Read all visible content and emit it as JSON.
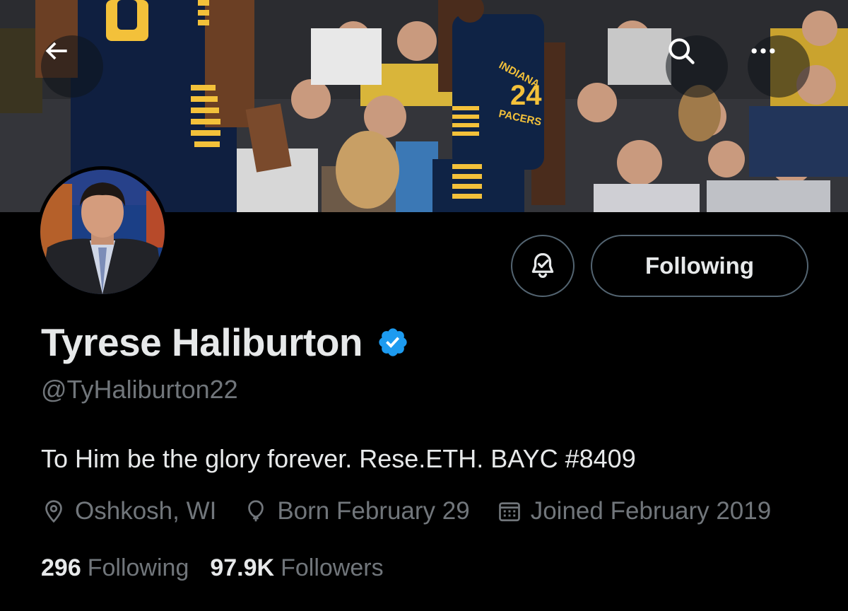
{
  "header": {
    "back_icon": "arrow-left-icon",
    "search_icon": "search-icon",
    "more_icon": "more-horizontal-icon"
  },
  "profile": {
    "display_name": "Tyrese Haliburton",
    "verified": true,
    "handle": "@TyHaliburton22",
    "bio": "To Him be the glory forever. Rese.ETH. BAYC #8409",
    "location": "Oshkosh, WI",
    "birthday": "Born February 29",
    "joined": "Joined February 2019"
  },
  "actions": {
    "notification_icon": "bell-check-icon",
    "follow_label": "Following"
  },
  "stats": {
    "following_count": "296",
    "following_label": "Following",
    "followers_count": "97.9K",
    "followers_label": "Followers"
  },
  "banner": {
    "jersey_number": "24",
    "jersey_text": "INDIANA PACERS",
    "partial_number": "0"
  },
  "colors": {
    "background": "#000000",
    "text_primary": "#e7e9ea",
    "text_secondary": "#71767b",
    "border": "#536471",
    "verified_blue": "#1d9bf0",
    "pacers_navy": "#0c2340",
    "pacers_gold": "#fdbb30"
  }
}
